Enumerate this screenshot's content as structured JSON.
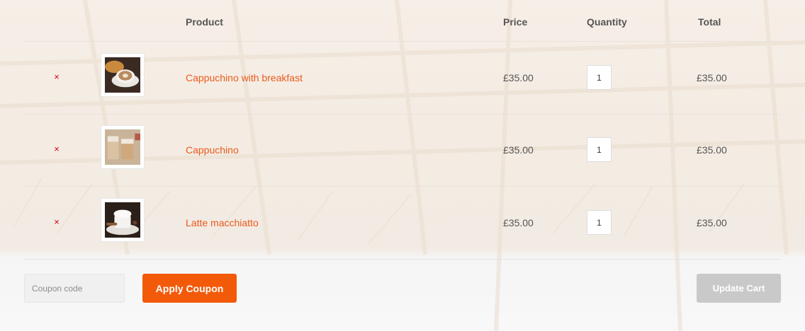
{
  "header": {
    "product": "Product",
    "price": "Price",
    "quantity": "Quantity",
    "total": "Total"
  },
  "items": [
    {
      "remove": "×",
      "name": "Cappuchino with breakfast",
      "price": "£35.00",
      "quantity": "1",
      "total": "£35.00",
      "thumb_icon": "coffee-breakfast-thumbnail"
    },
    {
      "remove": "×",
      "name": "Cappuchino",
      "price": "£35.00",
      "quantity": "1",
      "total": "£35.00",
      "thumb_icon": "cappuccino-glass-thumbnail"
    },
    {
      "remove": "×",
      "name": "Latte macchiatto",
      "price": "£35.00",
      "quantity": "1",
      "total": "£35.00",
      "thumb_icon": "latte-cup-thumbnail"
    }
  ],
  "actions": {
    "coupon_placeholder": "Coupon code",
    "apply_coupon": "Apply Coupon",
    "update_cart": "Update Cart"
  },
  "colors": {
    "accent": "#f25a0a",
    "link": "#e95a1c",
    "remove": "#d0021b",
    "disabled": "#c9c9c9"
  }
}
